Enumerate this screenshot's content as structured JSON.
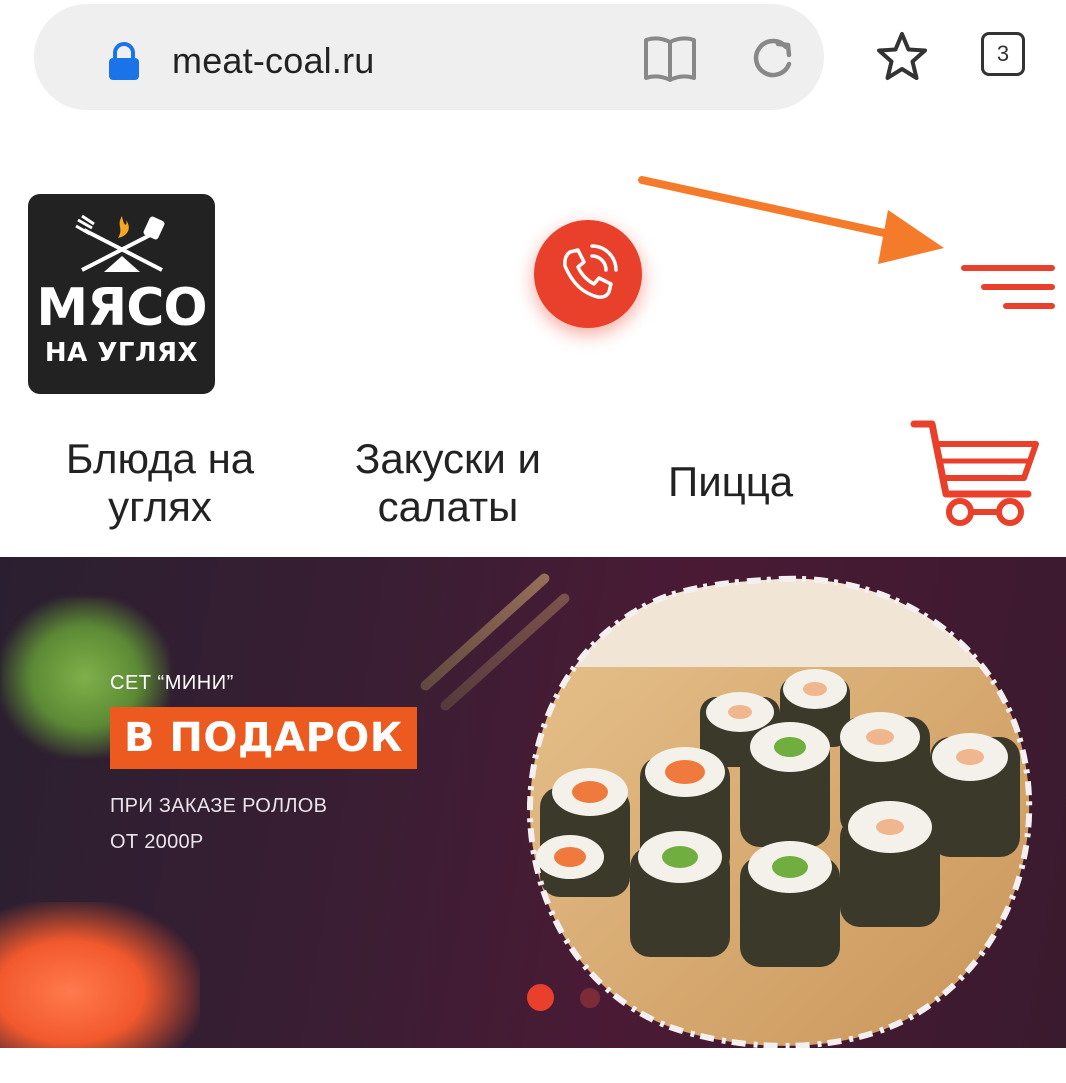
{
  "browser": {
    "url": "meat-coal.ru",
    "tabs_count": "3",
    "icons": [
      "lock-icon",
      "reader-mode-icon",
      "reload-icon",
      "star-icon",
      "tabs-icon"
    ]
  },
  "header": {
    "logo": {
      "line1": "МЯСО",
      "line2": "НА УГЛЯХ"
    },
    "icons": [
      "phone-call-icon",
      "menu-icon",
      "cart-icon",
      "arrow-annotation-icon"
    ]
  },
  "categories": [
    {
      "line1": "Блюда на",
      "line2": "углях"
    },
    {
      "line1": "Закуски и",
      "line2": "салаты"
    },
    {
      "line1": "Пицца",
      "line2": ""
    }
  ],
  "banner": {
    "top_text": "СЕТ “МИНИ”",
    "badge": "В ПОДАРОК",
    "sub1": "ПРИ ЗАКАЗЕ РОЛЛОВ",
    "sub2": "ОТ 2000Р",
    "slides_total": 2,
    "active_slide": 1
  },
  "colors": {
    "accent": "#e8402a",
    "badge": "#ec5a1f",
    "arrow": "#f47b2a",
    "banner_bg": "#3a1e33"
  }
}
